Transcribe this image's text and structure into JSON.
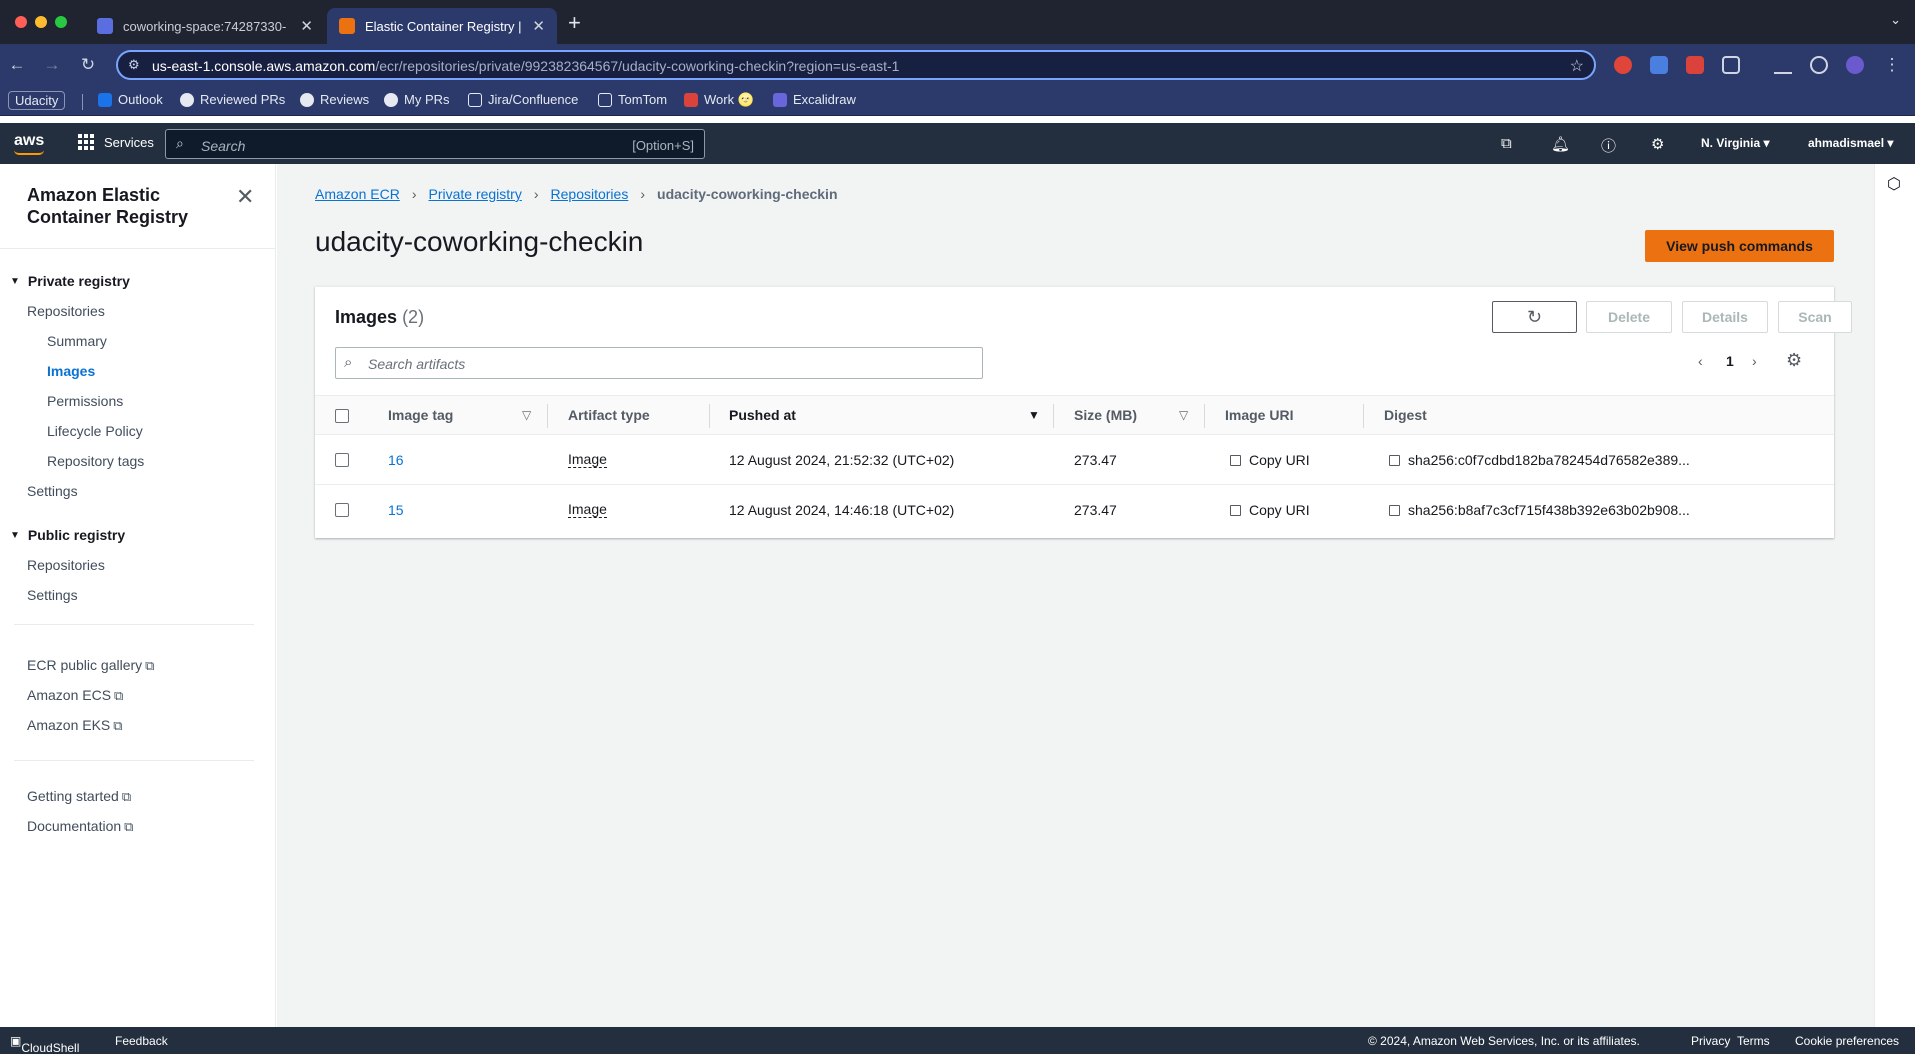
{
  "browser": {
    "tabs": [
      {
        "title": "coworking-space:74287330-",
        "favicon_color": "#5a6ee0"
      },
      {
        "title": "Elastic Container Registry | us",
        "favicon_color": "#ec7211"
      }
    ],
    "url_host": "us-east-1.console.aws.amazon.com",
    "url_path": "/ecr/repositories/private/992382364567/udacity-coworking-checkin?region=us-east-1",
    "bookmarks": [
      "Udacity",
      "Outlook",
      "Reviewed PRs",
      "Reviews",
      "My PRs",
      "Jira/Confluence",
      "TomTom",
      "Work 🌝",
      "Excalidraw"
    ]
  },
  "awsnav": {
    "logo": "aws",
    "services_label": "Services",
    "search_placeholder": "Search",
    "search_shortcut": "[Option+S]",
    "region": "N. Virginia",
    "account": "ahmadismael"
  },
  "sidebar": {
    "title": "Amazon Elastic Container Registry",
    "private_registry": "Private registry",
    "private_items": [
      "Repositories",
      "Summary",
      "Images",
      "Permissions",
      "Lifecycle Policy",
      "Repository tags",
      "Settings"
    ],
    "public_registry": "Public registry",
    "public_items": [
      "Repositories",
      "Settings"
    ],
    "external_links": [
      "ECR public gallery",
      "Amazon ECS",
      "Amazon EKS"
    ],
    "help_links": [
      "Getting started",
      "Documentation"
    ]
  },
  "breadcrumb": [
    "Amazon ECR",
    "Private registry",
    "Repositories",
    "udacity-coworking-checkin"
  ],
  "page": {
    "title": "udacity-coworking-checkin",
    "push_button": "View push commands"
  },
  "images": {
    "heading": "Images",
    "count": "(2)",
    "buttons": {
      "delete": "Delete",
      "details": "Details",
      "scan": "Scan"
    },
    "search_placeholder": "Search artifacts",
    "page": "1",
    "columns": [
      "Image tag",
      "Artifact type",
      "Pushed at",
      "Size (MB)",
      "Image URI",
      "Digest"
    ],
    "rows": [
      {
        "tag": "16",
        "type": "Image",
        "pushed": "12 August 2024, 21:52:32 (UTC+02)",
        "size": "273.47",
        "uri": "Copy URI",
        "digest": "sha256:c0f7cdbd182ba782454d76582e389..."
      },
      {
        "tag": "15",
        "type": "Image",
        "pushed": "12 August 2024, 14:46:18 (UTC+02)",
        "size": "273.47",
        "uri": "Copy URI",
        "digest": "sha256:b8af7c3cf715f438b392e63b02b908..."
      }
    ]
  },
  "footer": {
    "cloudshell": "CloudShell",
    "feedback": "Feedback",
    "copyright": "© 2024, Amazon Web Services, Inc. or its affiliates.",
    "privacy": "Privacy",
    "terms": "Terms",
    "cookies": "Cookie preferences"
  },
  "colors": {
    "accent": "#ec7211",
    "link": "#0972d3",
    "aws_nav": "#232f3e"
  }
}
